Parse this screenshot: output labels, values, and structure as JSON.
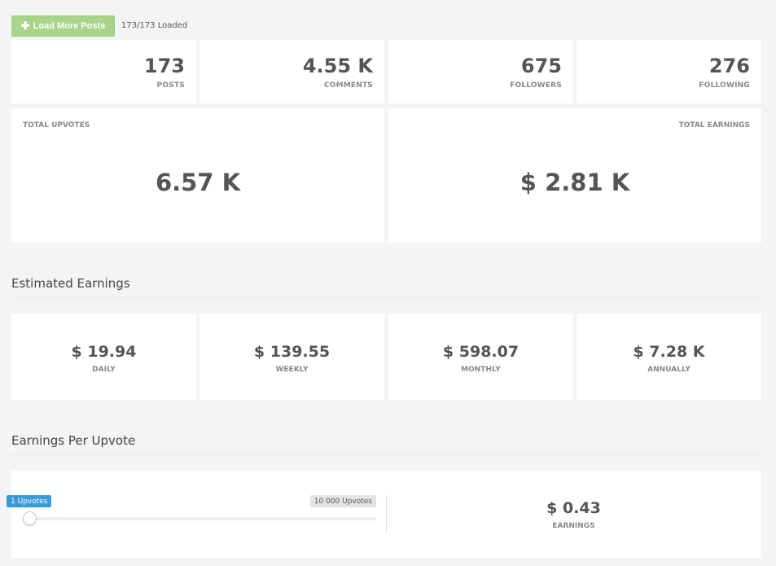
{
  "toolbar": {
    "load_more_label": "Load More Posts",
    "load_more_icon": "plus-icon",
    "loaded_status": "173/173 Loaded"
  },
  "stats": [
    {
      "value": "173",
      "label": "POSTS"
    },
    {
      "value": "4.55 K",
      "label": "COMMENTS"
    },
    {
      "value": "675",
      "label": "FOLLOWERS"
    },
    {
      "value": "276",
      "label": "FOLLOWING"
    }
  ],
  "totals": {
    "upvotes_label": "TOTAL UPVOTES",
    "upvotes_value": "6.57 K",
    "earnings_label": "TOTAL EARNINGS",
    "earnings_value": "$ 2.81 K"
  },
  "estimated": {
    "title": "Estimated Earnings",
    "items": [
      {
        "value": "$ 19.94",
        "label": "DAILY"
      },
      {
        "value": "$ 139.55",
        "label": "WEEKLY"
      },
      {
        "value": "$ 598.07",
        "label": "MONTHLY"
      },
      {
        "value": "$ 7.28 K",
        "label": "ANNUALLY"
      }
    ]
  },
  "per_upvote": {
    "title": "Earnings Per Upvote",
    "slider_min_label": "1 Upvotes",
    "slider_max_label": "10 000 Upvotes",
    "slider_value": 1,
    "earnings_value": "$ 0.43",
    "earnings_label": "EARNINGS"
  },
  "colors": {
    "accent_green": "#a8d58a",
    "accent_blue": "#3a9ad9",
    "background": "#f3f4f6"
  }
}
